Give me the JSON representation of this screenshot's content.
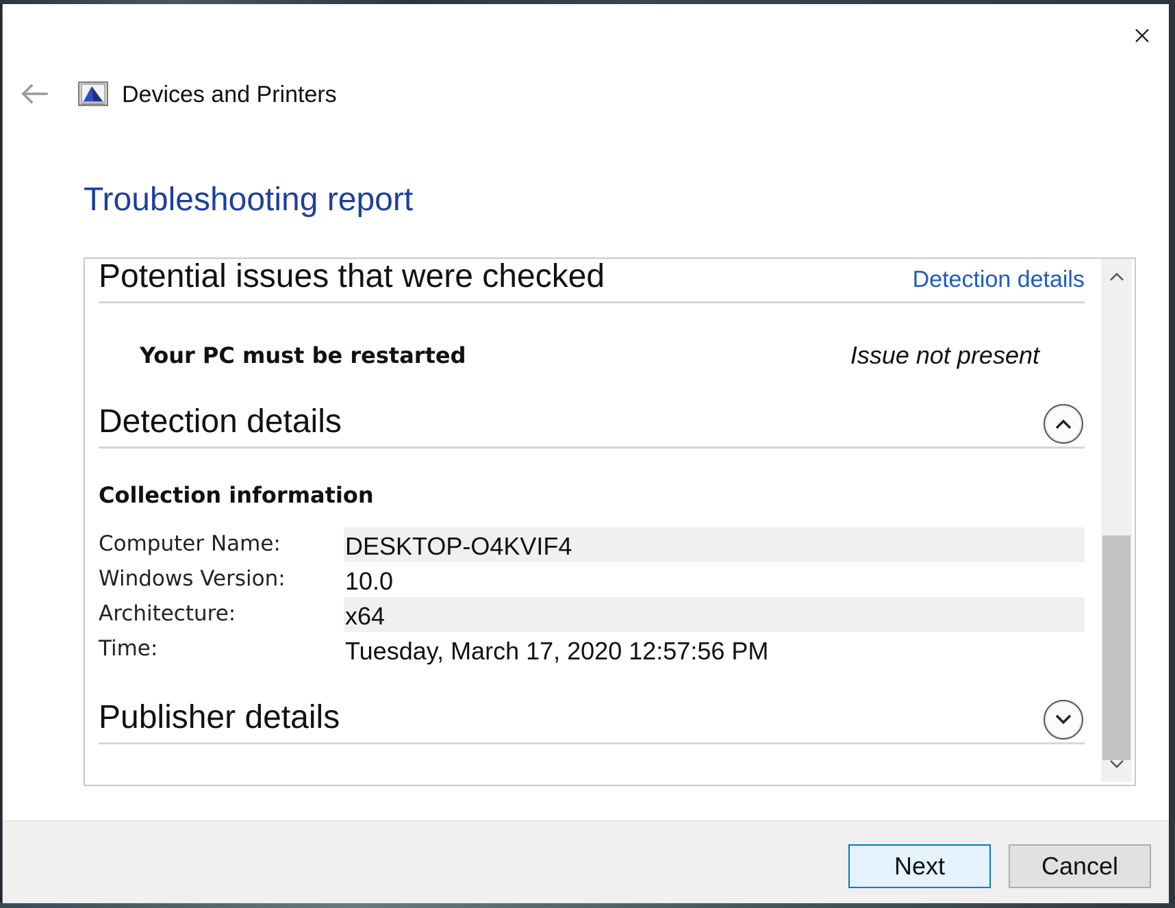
{
  "window": {
    "app_title": "Devices and Printers",
    "page_title": "Troubleshooting report"
  },
  "icons": {
    "close": "close-icon",
    "back": "back-arrow-icon",
    "app": "devices-and-printers-icon",
    "collapse": "chevron-up-icon",
    "expand": "chevron-down-icon"
  },
  "report": {
    "issues_section": {
      "heading": "Potential issues that were checked",
      "link_label": "Detection details"
    },
    "issue": {
      "name": "Your PC must be restarted",
      "status": "Issue not present"
    },
    "detection_section": {
      "heading": "Detection details",
      "subheading": "Collection information",
      "rows": [
        {
          "label": "Computer Name:",
          "value": "DESKTOP-O4KVIF4"
        },
        {
          "label": "Windows Version:",
          "value": "10.0"
        },
        {
          "label": "Architecture:",
          "value": "x64"
        },
        {
          "label": "Time:",
          "value": "Tuesday, March 17, 2020 12:57:56 PM"
        }
      ]
    },
    "publisher_section": {
      "heading": "Publisher details"
    }
  },
  "footer": {
    "next_label": "Next",
    "cancel_label": "Cancel"
  },
  "colors": {
    "title_blue": "#1e3f9e",
    "link_blue": "#1e5cbf",
    "accent": "#0078d7"
  }
}
